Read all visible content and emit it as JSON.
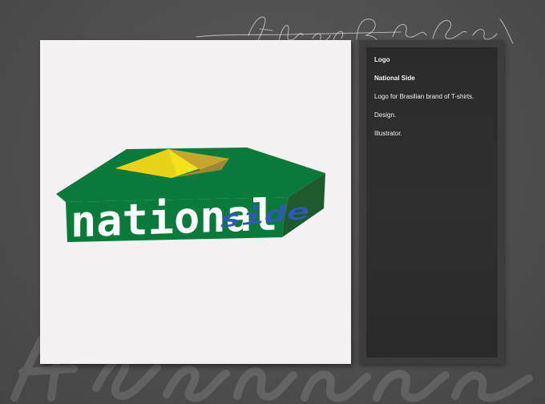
{
  "info": {
    "category": "Logo",
    "title": "National Side",
    "description": "Logo for Brasilian brand of T-shirts.",
    "service": "Design.",
    "tool": "Illustrator."
  },
  "logo": {
    "line1": "national",
    "line2": "side"
  },
  "signature": {
    "text": "Alexandre"
  },
  "colors": {
    "logo_green": "#0a7a3a",
    "logo_dark_green": "#1e5a2c",
    "logo_yellow": "#f4e21a",
    "logo_blue": "#2f59b3",
    "panel_bg": "#f4f1f2",
    "info_bg": "#2c2c2c"
  }
}
